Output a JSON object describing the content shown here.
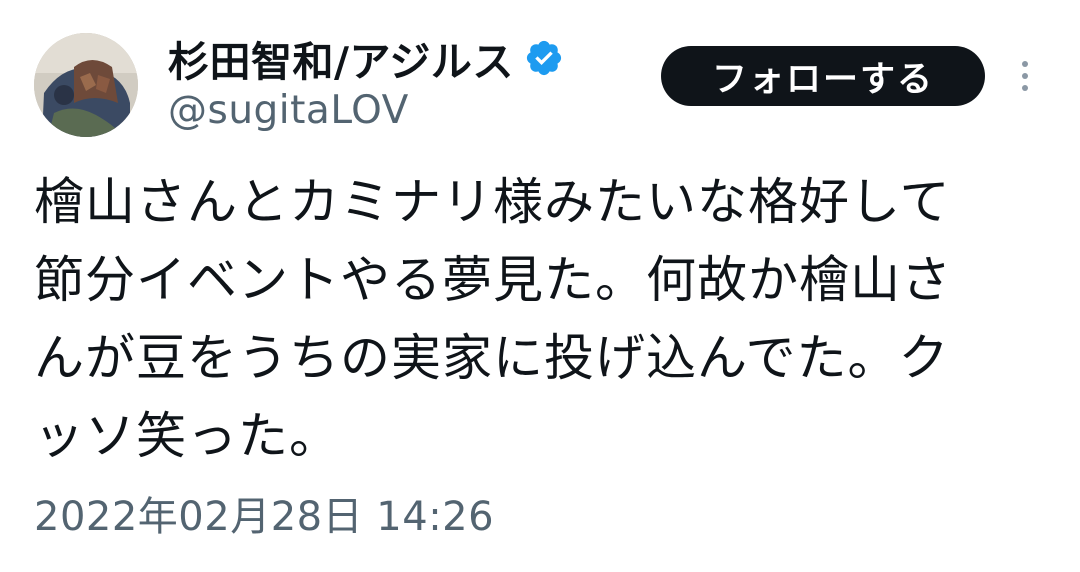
{
  "tweet": {
    "author": {
      "display_name": "杉田智和/アジルス",
      "handle": "@sugitaLOV",
      "verified": true
    },
    "follow_label": "フォローする",
    "body": "檜山さんとカミナリ様みたいな格好して\n節分イベントやる夢見た。何故か檜山さ\nんが豆をうちの実家に投げ込んでた。ク\nッソ笑った。",
    "timestamp": "2022年02月28日 14:26"
  },
  "icons": {
    "verified": "verified-badge-icon",
    "more": "more-vertical-icon"
  },
  "colors": {
    "verified": "#1d9bf0",
    "follow_bg": "#0f1419",
    "secondary_text": "#536471"
  }
}
